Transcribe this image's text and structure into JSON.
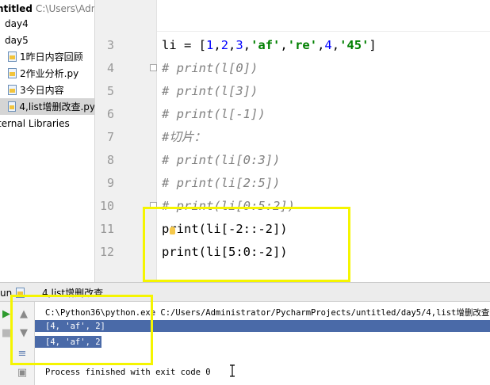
{
  "project": {
    "root_name": "ntitled",
    "root_path": "C:\\Users\\Adm",
    "items": [
      {
        "label": "day4",
        "kind": "folder"
      },
      {
        "label": "day5",
        "kind": "folder"
      },
      {
        "label": "1昨日内容回顾",
        "kind": "file"
      },
      {
        "label": "2作业分析.py",
        "kind": "file"
      },
      {
        "label": "3今日内容",
        "kind": "file"
      },
      {
        "label": "4,list增删改查.py",
        "kind": "file",
        "selected": true
      },
      {
        "label": "ternal Libraries",
        "kind": "libraries"
      }
    ]
  },
  "editor": {
    "line_numbers": [
      "3",
      "4",
      "5",
      "6",
      "7",
      "8",
      "9",
      "10",
      "11",
      "12"
    ],
    "lines": [
      {
        "segments": [
          {
            "t": "li = [",
            "c": "plain"
          },
          {
            "t": "1",
            "c": "num"
          },
          {
            "t": ",",
            "c": "plain"
          },
          {
            "t": "2",
            "c": "num"
          },
          {
            "t": ",",
            "c": "plain"
          },
          {
            "t": "3",
            "c": "num"
          },
          {
            "t": ",",
            "c": "plain"
          },
          {
            "t": "'af'",
            "c": "str"
          },
          {
            "t": ",",
            "c": "plain"
          },
          {
            "t": "'re'",
            "c": "str"
          },
          {
            "t": ",",
            "c": "plain"
          },
          {
            "t": "4",
            "c": "num"
          },
          {
            "t": ",",
            "c": "plain"
          },
          {
            "t": "'45'",
            "c": "str"
          },
          {
            "t": "]",
            "c": "plain"
          }
        ]
      },
      {
        "segments": [
          {
            "t": "# print(l[0])",
            "c": "comment"
          }
        ]
      },
      {
        "segments": [
          {
            "t": "# print(l[3])",
            "c": "comment"
          }
        ]
      },
      {
        "segments": [
          {
            "t": "# print(l[-1])",
            "c": "comment"
          }
        ]
      },
      {
        "segments": [
          {
            "t": "#切片：",
            "c": "comment"
          }
        ]
      },
      {
        "segments": [
          {
            "t": "# print(li[0:3])",
            "c": "comment"
          }
        ]
      },
      {
        "segments": [
          {
            "t": "# print(li[2:5])",
            "c": "comment"
          }
        ]
      },
      {
        "segments": [
          {
            "t": "# print(li[0:5:2])",
            "c": "comment"
          }
        ]
      },
      {
        "segments": [
          {
            "t": "print(li[-2::-2])",
            "c": "plain"
          }
        ]
      },
      {
        "segments": [
          {
            "t": "print(li[5:0:-2])",
            "c": "plain"
          }
        ]
      }
    ]
  },
  "run": {
    "tab_prefix": "un",
    "tab_label": "4,list增删改查",
    "command": "C:\\Python36\\python.exe C:/Users/Administrator/PycharmProjects/untitled/day5/4,list增删改查.py",
    "output_lines": [
      "[4, 'af', 2]",
      "[4, 'af', 2]"
    ],
    "exit_message": "Process finished with exit code 0"
  },
  "icons": {
    "toolbar": [
      "rerun-icon",
      "up-arrow-icon",
      "stop-icon",
      "down-arrow-icon",
      "soft-wrap-icon",
      "print-icon"
    ]
  },
  "colors": {
    "highlight_box": "#f5f500",
    "selection": "#4a6aa8",
    "comment": "#808080",
    "string": "#008000",
    "number": "#0000ff"
  }
}
